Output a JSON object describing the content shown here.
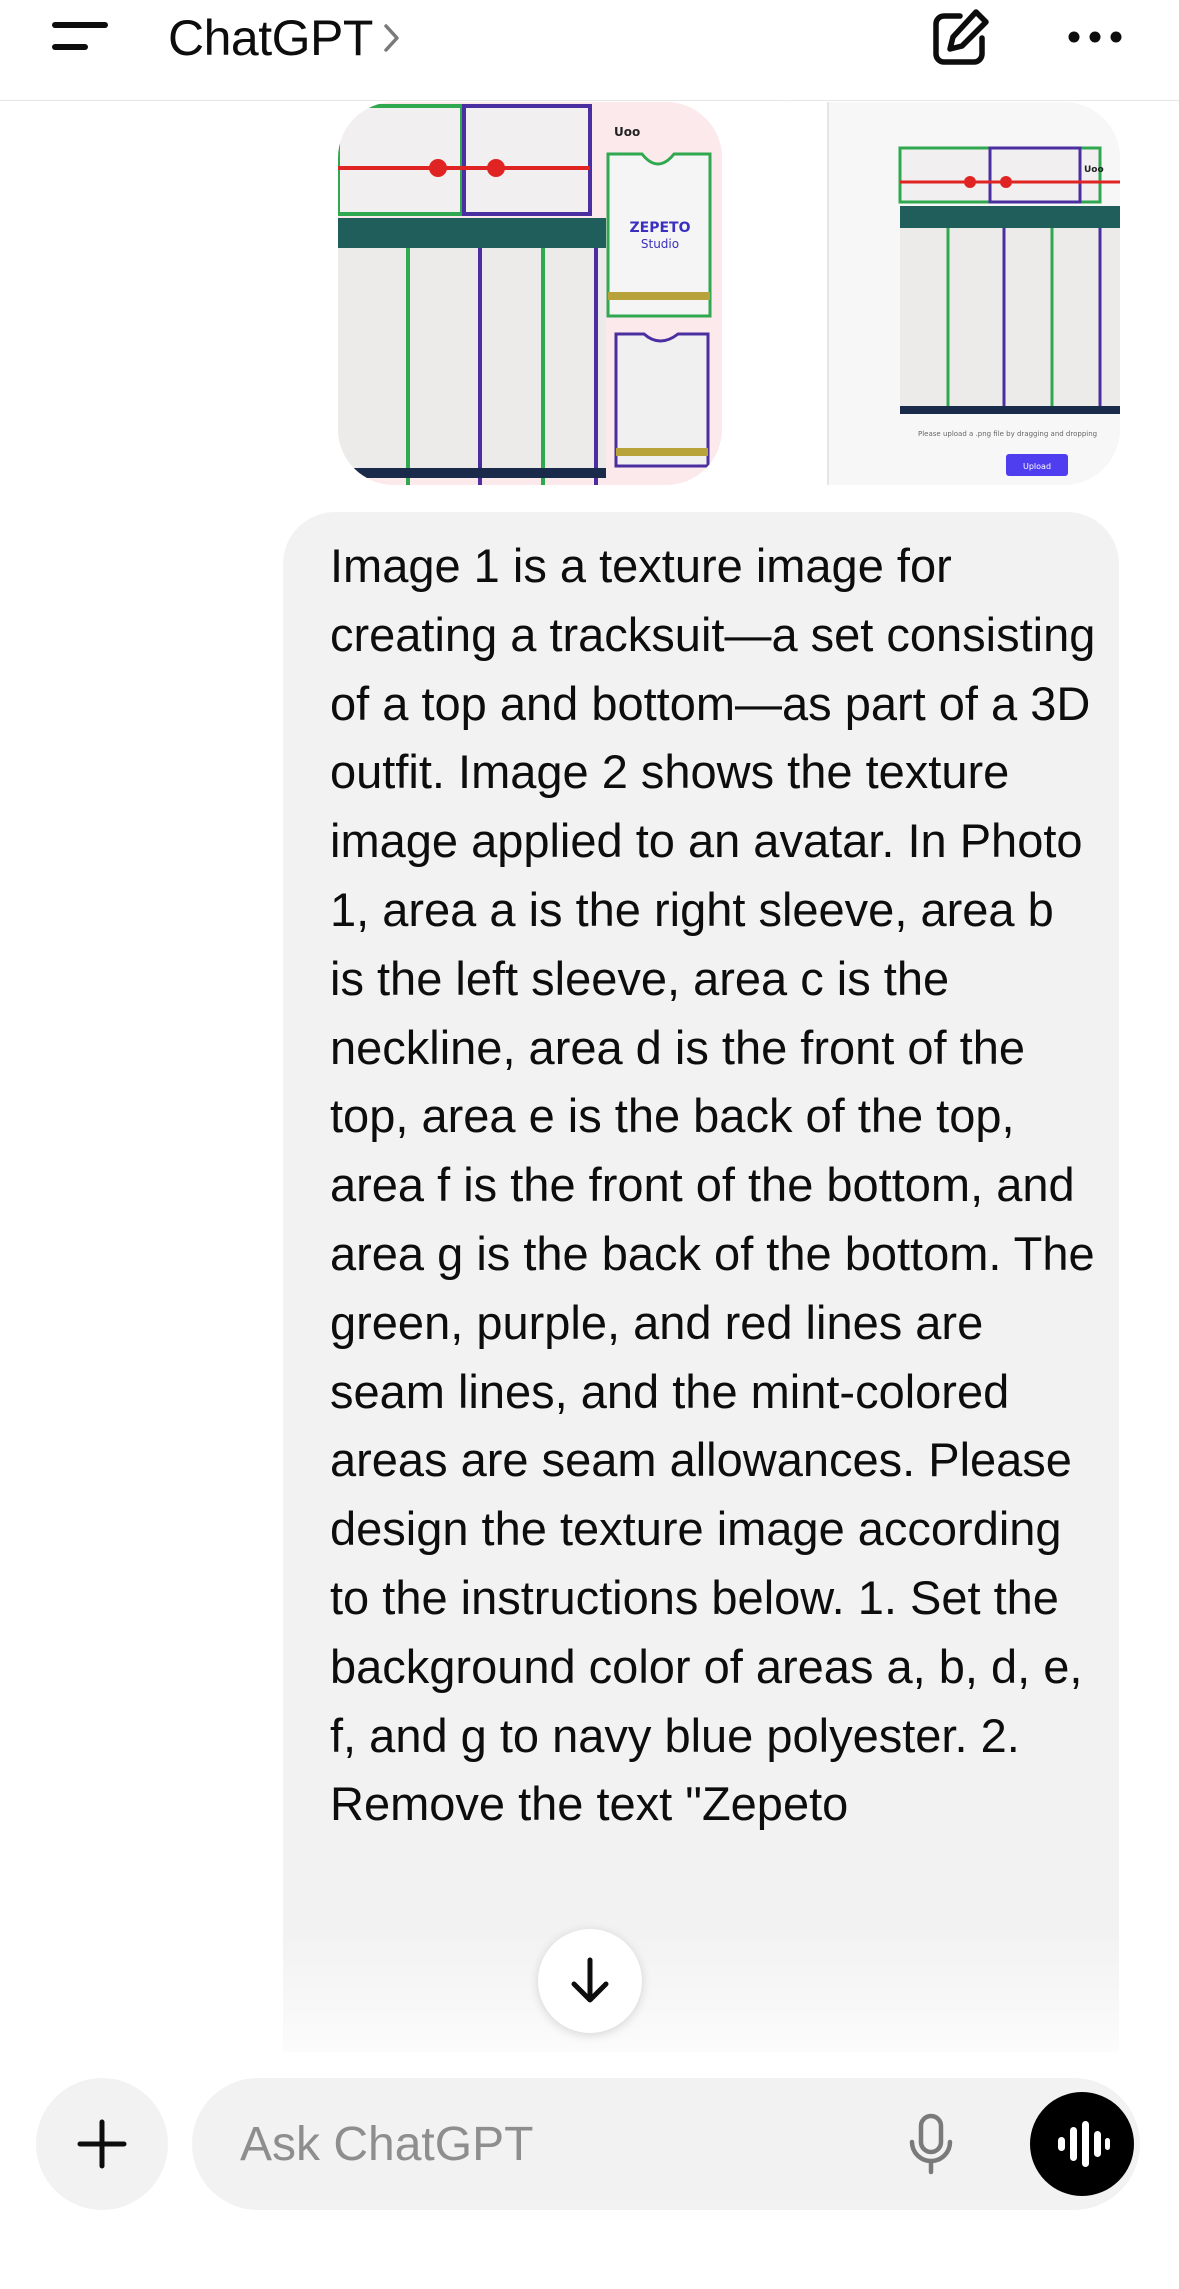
{
  "header": {
    "title": "ChatGPT",
    "menu_icon": "menu-icon",
    "compose_icon": "compose-icon",
    "more_icon": "more-icon"
  },
  "attachments": {
    "image1": {
      "logo_text": "ZEPETO",
      "logo_sub": "Studio",
      "corner_text": "Uoo"
    },
    "image2": {
      "hint_text": "Please upload a .png file by dragging and dropping",
      "upload_label": "Upload",
      "corner_text": "Uoo"
    }
  },
  "message": {
    "text": "Image 1 is a texture image for creating a tracksuit—a set consisting of a top and bottom—as part of a 3D outfit. Image 2 shows the texture image applied to an avatar. In Photo 1, area a is the right sleeve, area b is the left sleeve, area c is the neckline, area d is the front of the top, area e is the back of the top, area f is the front of the bottom, and area g is the back of the bottom. The green, purple, and red lines are seam lines, and the mint-colored areas are seam allowances. Please design the texture image according to the instructions below. 1. Set the background color of areas a, b, d, e, f, and g to navy blue polyester. 2. Remove the text \"Zepeto"
  },
  "scroll_button": {
    "icon": "arrow-down-icon"
  },
  "composer": {
    "placeholder": "Ask ChatGPT",
    "plus_icon": "plus-icon",
    "mic_icon": "mic-icon",
    "voice_icon": "voice-waveform-icon"
  },
  "colors": {
    "bubble_bg": "#f2f2f2",
    "seam_green": "#2fa84f",
    "seam_purple": "#4b2fa0",
    "seam_red": "#e02424",
    "seam_allowance_mint": "#1f5e5b",
    "upload_button": "#4f3df0"
  }
}
